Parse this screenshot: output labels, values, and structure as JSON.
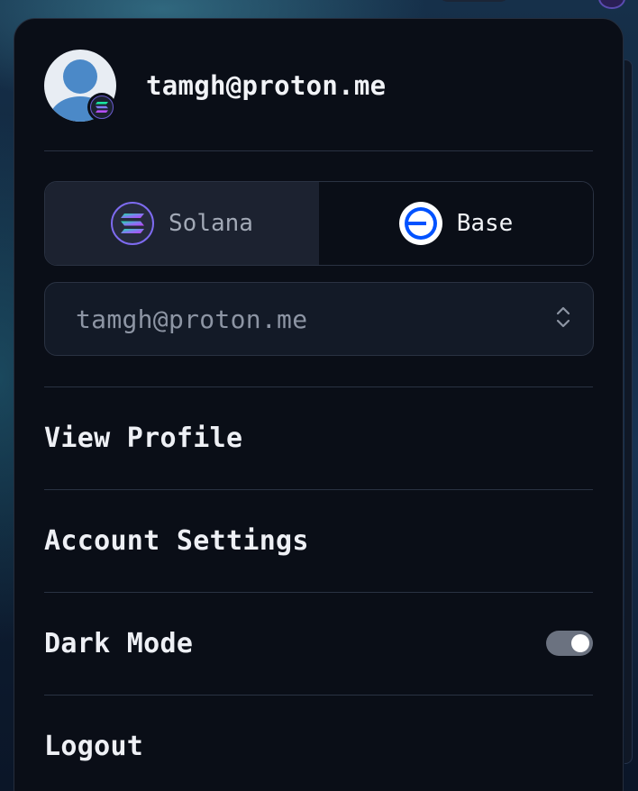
{
  "account": {
    "email": "tamgh@proton.me",
    "avatar_icon": "user-avatar-icon",
    "badge_icon": "solana-icon"
  },
  "chain_switch": {
    "options": [
      {
        "label": "Solana",
        "icon": "solana-icon",
        "selected": false
      },
      {
        "label": "Base",
        "icon": "base-icon",
        "selected": true
      }
    ]
  },
  "wallet_select": {
    "value": "tamgh@proton.me",
    "icon": "chevron-up-down-icon"
  },
  "menu": {
    "view_profile": "View Profile",
    "account_settings": "Account Settings",
    "dark_mode": "Dark Mode",
    "dark_mode_enabled": true,
    "logout": "Logout"
  },
  "colors": {
    "panel_bg": "#0a0e17",
    "border": "#2a3242",
    "base_blue": "#0052ff",
    "solana_purple": "#9945ff",
    "solana_green": "#14f195"
  }
}
